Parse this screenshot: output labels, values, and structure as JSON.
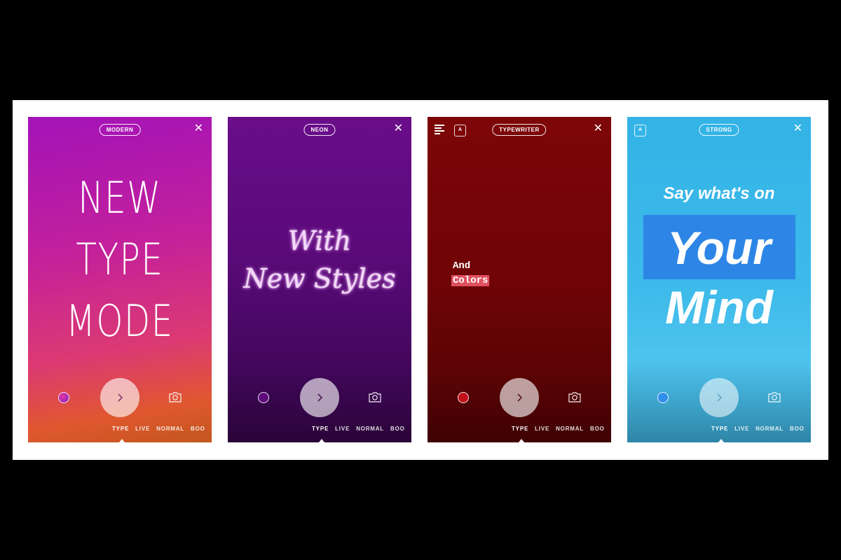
{
  "panels": [
    {
      "style_label": "MODERN",
      "lines": [
        "NEW",
        "TYPE",
        "MODE"
      ],
      "color_dot": "#c81fa3",
      "modes": [
        "TYPE",
        "LIVE",
        "NORMAL",
        "BOO"
      ],
      "active_mode": "TYPE"
    },
    {
      "style_label": "NEON",
      "lines": [
        "With",
        "New Styles"
      ],
      "color_dot": "#5e0b7c",
      "modes": [
        "TYPE",
        "LIVE",
        "NORMAL",
        "BOO"
      ],
      "active_mode": "TYPE"
    },
    {
      "style_label": "TYPEWRITER",
      "lines": [
        "And",
        "Colors"
      ],
      "highlight_color": "#e0505f",
      "color_dot": "#c0101a",
      "text_style_icon": "A",
      "modes": [
        "TYPE",
        "LIVE",
        "NORMAL",
        "BOO"
      ],
      "active_mode": "TYPE"
    },
    {
      "style_label": "STRONG",
      "lines": [
        "Say what's on",
        "Your",
        "Mind"
      ],
      "highlight_color": "#2d86e6",
      "color_dot": "#2f8fea",
      "text_style_icon": "A",
      "modes": [
        "TYPE",
        "LIVE",
        "NORMAL",
        "BOO"
      ],
      "active_mode": "TYPE"
    }
  ],
  "icons": {
    "close": "✕"
  }
}
